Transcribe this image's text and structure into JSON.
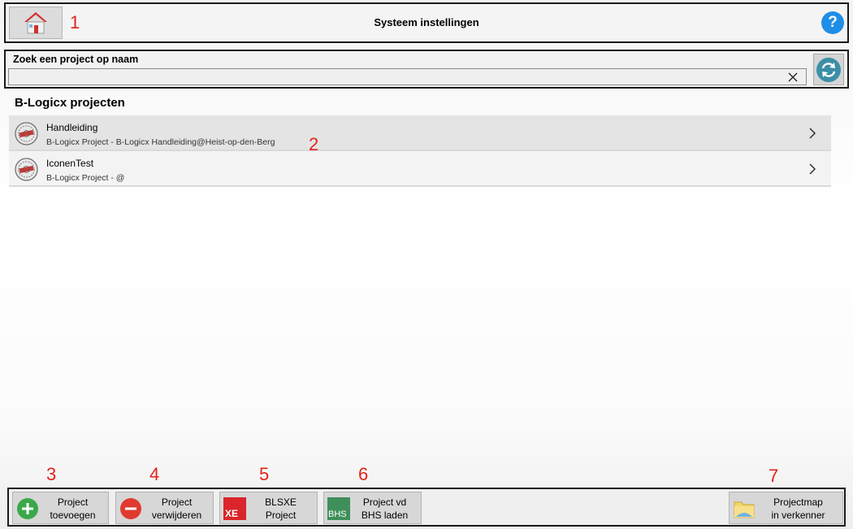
{
  "header": {
    "title": "Systeem instellingen",
    "help_symbol": "?",
    "home_icon": "home-icon"
  },
  "search": {
    "label": "Zoek een project op naam",
    "value": "",
    "placeholder": ""
  },
  "projects": {
    "section_title": "B-Logicx projecten",
    "items": [
      {
        "name": "Handleiding",
        "subtitle": "B-Logicx Project - B-Logicx Handleiding@Heist-op-den-Berg"
      },
      {
        "name": "IconenTest",
        "subtitle": "B-Logicx Project - @"
      }
    ]
  },
  "toolbar": {
    "add": {
      "line1": "Project",
      "line2": "toevoegen",
      "icon": "plus-circle-icon"
    },
    "remove": {
      "line1": "Project",
      "line2": "verwijderen",
      "icon": "minus-circle-icon"
    },
    "blsxe": {
      "line1": "BLSXE",
      "line2": "Project",
      "icon_text": "XE"
    },
    "bhs": {
      "line1": "Project vd",
      "line2": "BHS laden",
      "icon_text": "BHS"
    },
    "folder": {
      "line1": "Projectmap",
      "line2": "in verkenner",
      "icon": "folder-icon"
    }
  },
  "annotations": [
    "1",
    "2",
    "3",
    "4",
    "5",
    "6",
    "7"
  ],
  "colors": {
    "accent_blue": "#1f8ee6",
    "annotation_red": "#e0231a",
    "add_green": "#3aa84a",
    "remove_red": "#e03a2f",
    "xe_red": "#d9252b",
    "bhs_green": "#3f8f5a"
  }
}
